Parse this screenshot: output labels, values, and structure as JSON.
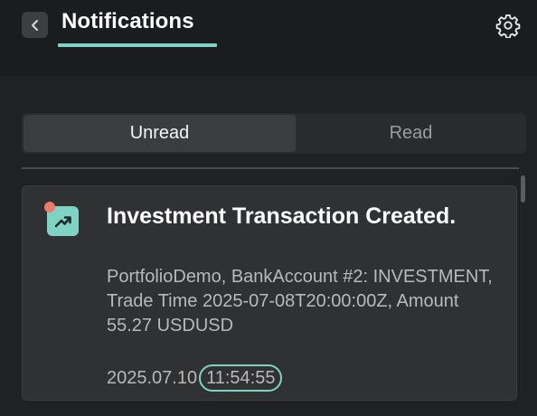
{
  "header": {
    "title": "Notifications",
    "back_icon": "chevron-left-icon",
    "settings_icon": "gear-icon"
  },
  "tabs": [
    {
      "label": "Unread",
      "active": true
    },
    {
      "label": "Read",
      "active": false
    }
  ],
  "notifications": [
    {
      "icon": "trending-up-icon",
      "unread": true,
      "title": "Investment Transaction Created.",
      "body": "PortfolioDemo, BankAccount #2: INVESTMENT, Trade Time 2025-07-08T20:00:00Z, Amount 55.27 USDUSD",
      "date": "2025.07.10",
      "time": "11:54:55"
    }
  ],
  "colors": {
    "accent": "#7fd3c4",
    "unread_dot": "#ee7b6a",
    "background": "#202122",
    "card": "#303133"
  }
}
